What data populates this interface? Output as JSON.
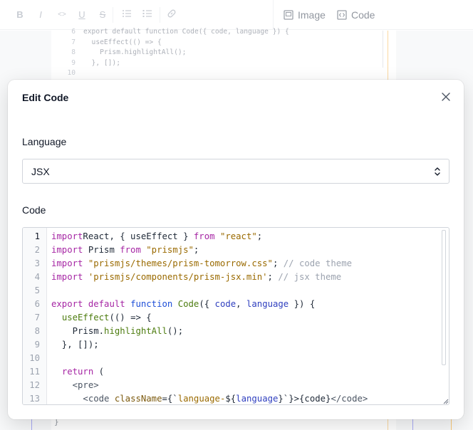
{
  "toolbar": {
    "icons": [
      "bold-icon",
      "italic-icon",
      "code-inline-icon",
      "underline-icon",
      "strikethrough-icon",
      "bullet-list-icon",
      "ordered-list-icon",
      "link-icon"
    ],
    "image_label": "Image",
    "code_label": "Code"
  },
  "background_code": {
    "lines": [
      {
        "n": "6",
        "text": "export default function Code({ code, language }) {"
      },
      {
        "n": "7",
        "text": "  useEffect(() => {"
      },
      {
        "n": "8",
        "text": "    Prism.highlightAll();"
      },
      {
        "n": "9",
        "text": "  }, []);"
      },
      {
        "n": "10",
        "text": ""
      }
    ],
    "closing_brace": "}"
  },
  "modal": {
    "title": "Edit Code",
    "language_label": "Language",
    "language_value": "JSX",
    "code_label": "Code",
    "active_line": 1,
    "code_lines": [
      {
        "n": "1",
        "tokens": [
          [
            "kw",
            "import"
          ],
          [
            "",
            "React, { useEffect } "
          ],
          [
            "kw",
            "from"
          ],
          [
            "",
            " "
          ],
          [
            "str",
            "\"react\""
          ],
          [
            "",
            ";"
          ]
        ]
      },
      {
        "n": "2",
        "tokens": [
          [
            "kw",
            "import"
          ],
          [
            "",
            " Prism "
          ],
          [
            "kw",
            "from"
          ],
          [
            "",
            " "
          ],
          [
            "str",
            "\"prismjs\""
          ],
          [
            "",
            ";"
          ]
        ]
      },
      {
        "n": "3",
        "tokens": [
          [
            "kw",
            "import"
          ],
          [
            "",
            " "
          ],
          [
            "str",
            "\"prismjs/themes/prism-tomorrow.css\""
          ],
          [
            "",
            "; "
          ],
          [
            "com",
            "// code theme"
          ]
        ]
      },
      {
        "n": "4",
        "tokens": [
          [
            "kw",
            "import"
          ],
          [
            "",
            " "
          ],
          [
            "str",
            "'prismjs/components/prism-jsx.min'"
          ],
          [
            "",
            "; "
          ],
          [
            "com",
            "// jsx theme"
          ]
        ]
      },
      {
        "n": "5",
        "tokens": []
      },
      {
        "n": "6",
        "tokens": [
          [
            "kw",
            "export"
          ],
          [
            "",
            " "
          ],
          [
            "kw",
            "default"
          ],
          [
            "",
            " "
          ],
          [
            "kw2",
            "function"
          ],
          [
            "",
            " "
          ],
          [
            "fn",
            "Code"
          ],
          [
            "",
            "({ "
          ],
          [
            "param",
            "code"
          ],
          [
            "",
            ", "
          ],
          [
            "param",
            "language"
          ],
          [
            "",
            " }) {"
          ]
        ]
      },
      {
        "n": "7",
        "tokens": [
          [
            "",
            "  "
          ],
          [
            "fn",
            "useEffect"
          ],
          [
            "",
            "(() => {"
          ]
        ]
      },
      {
        "n": "8",
        "tokens": [
          [
            "",
            "    Prism."
          ],
          [
            "fn",
            "highlightAll"
          ],
          [
            "",
            "();"
          ]
        ]
      },
      {
        "n": "9",
        "tokens": [
          [
            "",
            "  }, []);"
          ]
        ]
      },
      {
        "n": "10",
        "tokens": []
      },
      {
        "n": "11",
        "tokens": [
          [
            "",
            "  "
          ],
          [
            "kw",
            "return"
          ],
          [
            "",
            " ("
          ]
        ]
      },
      {
        "n": "12",
        "tokens": [
          [
            "",
            "    "
          ],
          [
            "tag",
            "<pre>"
          ]
        ]
      },
      {
        "n": "13",
        "tokens": [
          [
            "",
            "      "
          ],
          [
            "tag",
            "<code"
          ],
          [
            "",
            " "
          ],
          [
            "attr",
            "className"
          ],
          [
            "",
            "={`"
          ],
          [
            "str",
            "language-"
          ],
          [
            "",
            "${"
          ],
          [
            "param",
            "language"
          ],
          [
            "",
            "}`}>{code}"
          ],
          [
            "tag",
            "</code>"
          ]
        ]
      }
    ]
  }
}
